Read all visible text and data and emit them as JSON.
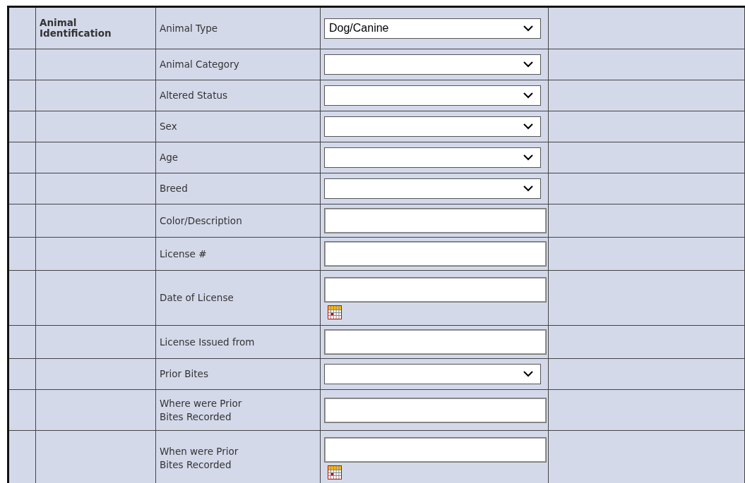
{
  "section": {
    "title": "Animal Identification"
  },
  "rows": [
    {
      "label": "Animal Type",
      "kind": "select",
      "value": "Dog/Canine"
    },
    {
      "label": "Animal Category",
      "kind": "select"
    },
    {
      "label": "Altered Status",
      "kind": "select"
    },
    {
      "label": "Sex",
      "kind": "select"
    },
    {
      "label": "Age",
      "kind": "select"
    },
    {
      "label": "Breed",
      "kind": "select"
    },
    {
      "label": "Color/Description",
      "kind": "text"
    },
    {
      "label": "License #",
      "kind": "text"
    },
    {
      "label": "Date of License",
      "kind": "date"
    },
    {
      "label": "License Issued from",
      "kind": "text"
    },
    {
      "label": "Prior Bites",
      "kind": "select"
    },
    {
      "label": "Where were Prior Bites Recorded",
      "kind": "text"
    },
    {
      "label": "When were Prior Bites Recorded",
      "kind": "date"
    }
  ]
}
